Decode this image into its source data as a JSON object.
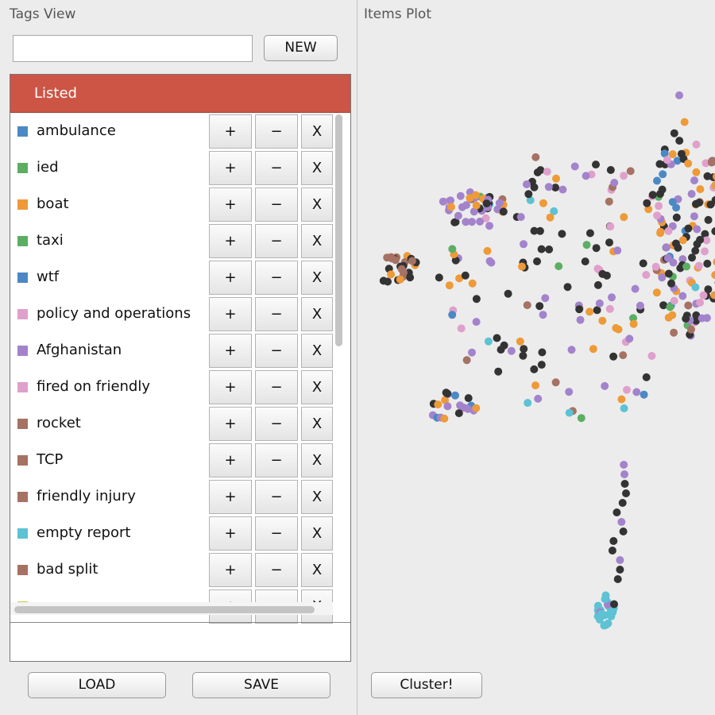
{
  "tags_view": {
    "title": "Tags View",
    "input_value": "",
    "new_label": "NEW",
    "list_header": "Listed",
    "button_plus": "+",
    "button_minus": "−",
    "button_x": "X",
    "tags": [
      {
        "label": "ambulance",
        "color": "#4c88c4"
      },
      {
        "label": "ied",
        "color": "#5cae63"
      },
      {
        "label": "boat",
        "color": "#ee9a38"
      },
      {
        "label": "taxi",
        "color": "#5cae63"
      },
      {
        "label": "wtf",
        "color": "#4c88c4"
      },
      {
        "label": "policy and operations",
        "color": "#dfa0cb"
      },
      {
        "label": "Afghanistan",
        "color": "#a383cc"
      },
      {
        "label": "fired on friendly",
        "color": "#dfa0cb"
      },
      {
        "label": "rocket",
        "color": "#a57264"
      },
      {
        "label": "TCP",
        "color": "#a57264"
      },
      {
        "label": "friendly injury",
        "color": "#a57264"
      },
      {
        "label": "empty report",
        "color": "#5cc2d4"
      },
      {
        "label": "bad split",
        "color": "#a57264"
      },
      {
        "label": "",
        "color": "#c9c74a"
      }
    ],
    "load_label": "LOAD",
    "save_label": "SAVE"
  },
  "items_plot": {
    "title": "Items Plot",
    "cluster_label": "Cluster!"
  }
}
